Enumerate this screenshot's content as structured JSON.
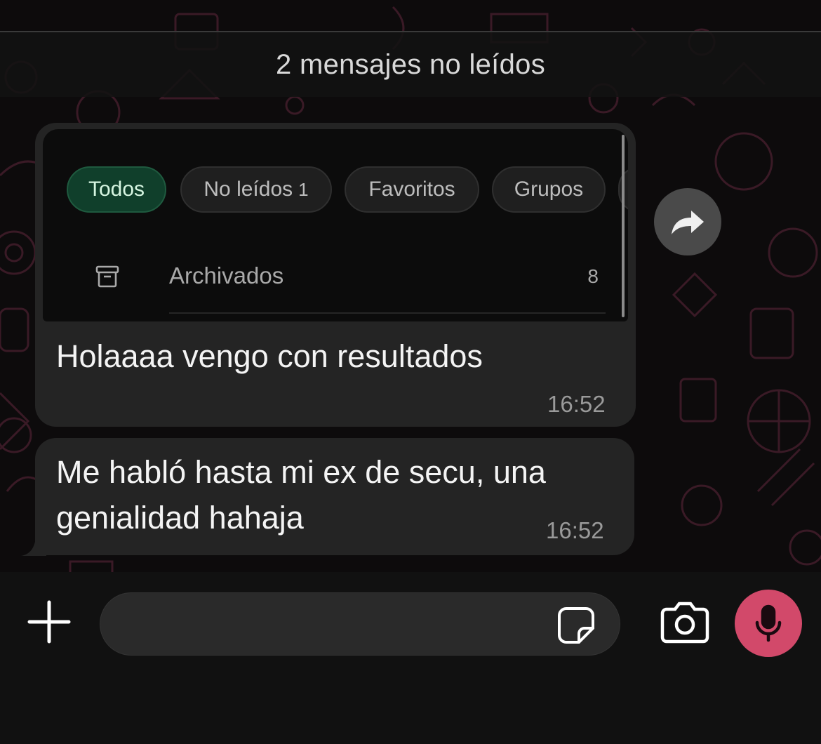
{
  "unread_banner": "2 mensajes no leídos",
  "quoted_screenshot": {
    "chips": [
      {
        "label": "Todos",
        "count": "",
        "active": true
      },
      {
        "label": "No leídos",
        "count": "1",
        "active": false
      },
      {
        "label": "Favoritos",
        "count": "",
        "active": false
      },
      {
        "label": "Grupos",
        "count": "",
        "active": false
      }
    ],
    "archive": {
      "label": "Archivados",
      "count": "8",
      "icon": "archive-icon"
    }
  },
  "messages": [
    {
      "text": "Holaaaa vengo con resultados",
      "time": "16:52"
    },
    {
      "text_line1": "Me habló hasta mi ex de secu, una",
      "text_line2": "genialidad hahaja",
      "time": "16:52"
    }
  ],
  "actions": {
    "forward_icon": "forward-arrow-icon",
    "attach_icon": "plus-icon",
    "sticker_icon": "sticker-icon",
    "camera_icon": "camera-icon",
    "mic_icon": "microphone-icon"
  },
  "colors": {
    "bubble": "#242424",
    "active_chip": "#103f2b",
    "mic_button": "#d2496a",
    "doodle": "#3a1a26"
  }
}
